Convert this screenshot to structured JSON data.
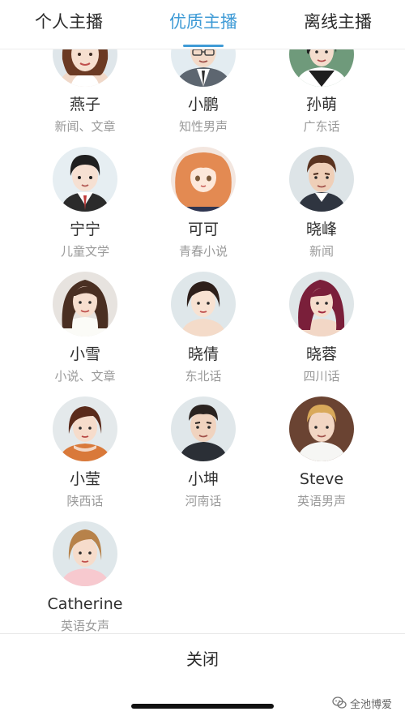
{
  "tabs": [
    {
      "label": "个人主播",
      "active": false
    },
    {
      "label": "优质主播",
      "active": true
    },
    {
      "label": "离线主播",
      "active": false
    }
  ],
  "accent_color": "#3f9bd6",
  "anchors": [
    {
      "name": "燕子",
      "desc": "新闻、文章",
      "avatar": "female-long-brown-hair-avatar"
    },
    {
      "name": "小鹏",
      "desc": "知性男声",
      "avatar": "male-suit-glasses-avatar"
    },
    {
      "name": "孙萌",
      "desc": "广东话",
      "avatar": "female-short-hair-avatar"
    },
    {
      "name": "宁宁",
      "desc": "儿童文学",
      "avatar": "boy-school-uniform-avatar"
    },
    {
      "name": "可可",
      "desc": "青春小说",
      "avatar": "anime-girl-avatar"
    },
    {
      "name": "晓峰",
      "desc": "新闻",
      "avatar": "male-brown-hair-avatar"
    },
    {
      "name": "小雪",
      "desc": "小说、文章",
      "avatar": "female-long-hair-avatar"
    },
    {
      "name": "晓倩",
      "desc": "东北话",
      "avatar": "female-bob-hair-avatar"
    },
    {
      "name": "晓蓉",
      "desc": "四川话",
      "avatar": "female-red-hair-avatar"
    },
    {
      "name": "小莹",
      "desc": "陕西话",
      "avatar": "female-bob-orange-top-avatar"
    },
    {
      "name": "小坤",
      "desc": "河南话",
      "avatar": "male-black-hair-avatar"
    },
    {
      "name": "Steve",
      "desc": "英语男声",
      "avatar": "male-blond-avatar"
    },
    {
      "name": "Catherine",
      "desc": "英语女声",
      "avatar": "female-blond-avatar"
    }
  ],
  "close_label": "关闭",
  "watermark": {
    "text": "全池博爱",
    "icon": "wechat-icon"
  }
}
